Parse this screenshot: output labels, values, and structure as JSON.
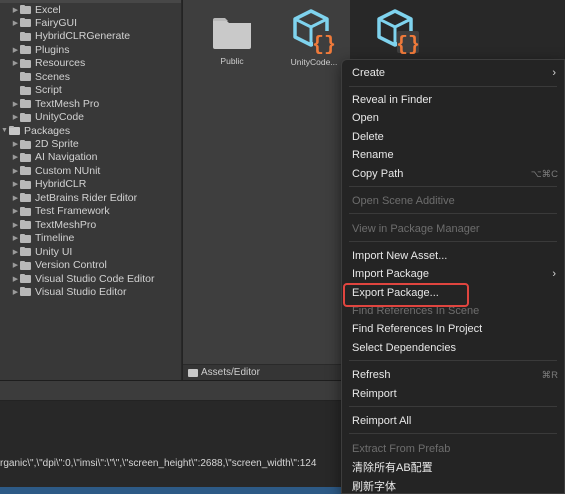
{
  "tree": {
    "items": [
      {
        "label": "Excel",
        "arrow": "▶",
        "open": false
      },
      {
        "label": "FairyGUI",
        "arrow": "▶",
        "open": false
      },
      {
        "label": "HybridCLRGenerate",
        "arrow": "",
        "open": false
      },
      {
        "label": "Plugins",
        "arrow": "▶",
        "open": false
      },
      {
        "label": "Resources",
        "arrow": "▶",
        "open": false
      },
      {
        "label": "Scenes",
        "arrow": "",
        "open": false
      },
      {
        "label": "Script",
        "arrow": "",
        "open": false
      },
      {
        "label": "TextMesh Pro",
        "arrow": "▶",
        "open": false
      },
      {
        "label": "UnityCode",
        "arrow": "▶",
        "open": false
      },
      {
        "label": "Packages",
        "arrow": "▼",
        "open": true
      },
      {
        "label": "2D Sprite",
        "arrow": "▶",
        "open": false
      },
      {
        "label": "AI Navigation",
        "arrow": "▶",
        "open": false
      },
      {
        "label": "Custom NUnit",
        "arrow": "▶",
        "open": false
      },
      {
        "label": "HybridCLR",
        "arrow": "▶",
        "open": false
      },
      {
        "label": "JetBrains Rider Editor",
        "arrow": "▶",
        "open": false
      },
      {
        "label": "Test Framework",
        "arrow": "▶",
        "open": false
      },
      {
        "label": "TextMeshPro",
        "arrow": "▶",
        "open": false
      },
      {
        "label": "Timeline",
        "arrow": "▶",
        "open": false
      },
      {
        "label": "Unity UI",
        "arrow": "▶",
        "open": false
      },
      {
        "label": "Version Control",
        "arrow": "▶",
        "open": false
      },
      {
        "label": "Visual Studio Code Editor",
        "arrow": "▶",
        "open": false
      },
      {
        "label": "Visual Studio Editor",
        "arrow": "▶",
        "open": false
      }
    ]
  },
  "grid": {
    "assets": [
      {
        "label": "Public",
        "icon": "folder-icon"
      },
      {
        "label": "UnityCode...",
        "icon": "assembly-definition-icon"
      },
      {
        "label": "",
        "icon": "assembly-definition-icon"
      }
    ],
    "footer_path": "Assets/Editor"
  },
  "console": {
    "line": "rganic\\\",\\\"dpi\\\":0,\\\"imsi\\\":\\\"\\\",\\\"screen_height\\\":2688,\\\"screen_width\\\":124"
  },
  "menu": {
    "create": "Create",
    "reveal": "Reveal in Finder",
    "open": "Open",
    "delete": "Delete",
    "rename": "Rename",
    "copy_path": "Copy Path",
    "copy_path_shortcut": "⌥⌘C",
    "open_scene_additive": "Open Scene Additive",
    "view_in_package_manager": "View in Package Manager",
    "import_new_asset": "Import New Asset...",
    "import_package": "Import Package",
    "export_package": "Export Package...",
    "find_refs_scene": "Find References In Scene",
    "find_refs_project": "Find References In Project",
    "select_dependencies": "Select Dependencies",
    "refresh": "Refresh",
    "refresh_shortcut": "⌘R",
    "reimport": "Reimport",
    "reimport_all": "Reimport All",
    "extract_from_prefab": "Extract From Prefab",
    "clear_ab": "清除所有AB配置",
    "refresh_font": "刷新字体"
  },
  "colors": {
    "highlight": "#e0453f",
    "asset_icon_blue": "#7fd3ee",
    "asset_icon_orange": "#f07a3a"
  }
}
